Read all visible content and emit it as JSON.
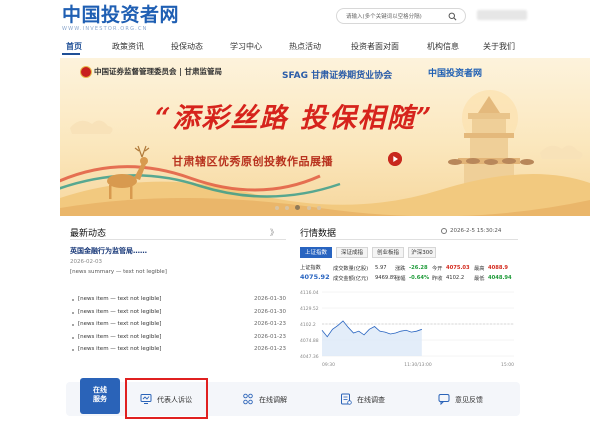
{
  "header": {
    "logo_title": "中国投资者网",
    "logo_subtitle": "WWW.INVESTOR.ORG.CN",
    "search_placeholder": "请输入(多个关键词以空格分隔)"
  },
  "nav": {
    "items": [
      "首页",
      "政策资讯",
      "投保动态",
      "学习中心",
      "热点活动",
      "投资者面对面",
      "机构信息",
      "关于我们"
    ],
    "active_index": 0
  },
  "banner": {
    "org1": "中国证券监督管理委员会",
    "org1_branch": "甘肃监管局",
    "org2": "SFAG 甘肃证券期货业协会",
    "org3": "中国投资者网",
    "title": "“添彩丝路 投保相随”",
    "subtitle": "甘肃辖区优秀原创投教作品展播",
    "slide_count": 5,
    "active_slide": 2
  },
  "news": {
    "heading": "最新动态",
    "more": "》",
    "headline": "英国金融行为监管局……",
    "headline_date": "2026-02-03",
    "summary": "[news summary — text not legible]",
    "items": [
      {
        "title": "[news item — text not legible]",
        "date": "2026-01-30"
      },
      {
        "title": "[news item — text not legible]",
        "date": "2026-01-30"
      },
      {
        "title": "[news item — text not legible]",
        "date": "2026-01-23"
      },
      {
        "title": "[news item — text not legible]",
        "date": "2026-01-23"
      },
      {
        "title": "[news item — text not legible]",
        "date": "2026-01-23"
      }
    ]
  },
  "market": {
    "heading": "行情数据",
    "timestamp": "2026-2-5 15:30:24",
    "tabs": [
      "上证指数",
      "深证成指",
      "创业板指",
      "沪深300"
    ],
    "active_tab": 0,
    "index_name": "上证指数",
    "index_value": "4075.92",
    "row1": {
      "vol_label": "成交数量(亿股)",
      "vol_val": "5.97",
      "chg_label": "涨跌",
      "chg_val": "-26.28",
      "open_label": "今开",
      "open_val": "4075.03",
      "high_label": "最高",
      "high_val": "4088.9"
    },
    "row2": {
      "amt_label": "成交金额(亿元)",
      "amt_val": "9469.89",
      "pct_label": "涨幅",
      "pct_val": "-0.64%",
      "prev_label": "昨收",
      "prev_val": "4102.2",
      "low_label": "最低",
      "low_val": "4048.94"
    },
    "colors": {
      "up": "#d42a1e",
      "down": "#1f9b3a",
      "accent": "#2864c0"
    }
  },
  "chart_data": {
    "type": "line",
    "title": "",
    "xlabel": "",
    "ylabel": "",
    "y_ticks": [
      "4116.04",
      "4129.52",
      "4102.2",
      "4074.88",
      "4047.36"
    ],
    "x_ticks": [
      "09:30",
      "11:30/13:00",
      "15:00"
    ],
    "ylim": [
      4047.36,
      4116.04
    ],
    "baseline": 4102.2,
    "series": [
      {
        "values": [
          4075,
          4068,
          4076,
          4080,
          4085,
          4078,
          4072,
          4074,
          4070,
          4076,
          4079,
          4074,
          4073,
          4071,
          4072,
          4074,
          4075,
          4073,
          4074,
          4076
        ]
      }
    ]
  },
  "services": {
    "badge_line1": "在线",
    "badge_line2": "服务",
    "items": [
      {
        "label": "代表人诉讼",
        "icon": "monitor-icon"
      },
      {
        "label": "在线调解",
        "icon": "people-icon"
      },
      {
        "label": "在线调查",
        "icon": "survey-icon"
      },
      {
        "label": "意见反馈",
        "icon": "chat-icon"
      }
    ]
  }
}
